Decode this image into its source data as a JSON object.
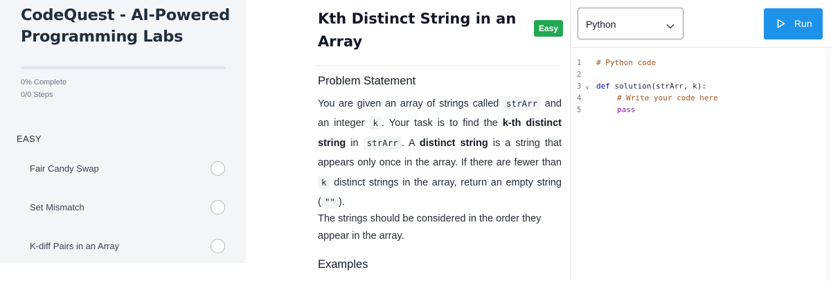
{
  "sidebar": {
    "app_title": "CodeQuest - AI-Powered Programming Labs",
    "progress_percent": 0,
    "progress_text": "0% Complete",
    "steps_text": "0/0 Steps",
    "level_heading": "EASY",
    "lessons": [
      {
        "label": "Fair Candy Swap",
        "completed": false
      },
      {
        "label": "Set Mismatch",
        "completed": false
      },
      {
        "label": "K-diff Pairs in an Array",
        "completed": false
      }
    ]
  },
  "problem": {
    "title": "Kth Distinct String in an Array",
    "difficulty": "Easy",
    "difficulty_color": "#22a853",
    "statement_heading": "Problem Statement",
    "statement": {
      "p1": "You are given an array of strings called ",
      "code1": "strArr",
      "p2": " and an integer ",
      "code2": "k",
      "p3": ". Your task is to find the ",
      "bold1": "k-th distinct string",
      "p4": " in ",
      "code3": "strArr",
      "p5": ". A ",
      "bold2": "distinct string",
      "p6": " is a string that appears only once in the array. If there are fewer than ",
      "code4": "k",
      "p7": " distinct strings in the array, return an empty string (",
      "code5": "\"\"",
      "p8": ")."
    },
    "order_note": "The strings should be considered in the order they appear in the array.",
    "examples_heading": "Examples"
  },
  "editor": {
    "language": "Python",
    "run_label": "Run",
    "accent_color": "#1d92e8",
    "line_numbers": [
      "1",
      "2",
      "3",
      "4",
      "5"
    ],
    "code": {
      "line1": "# Python code",
      "line3_kw": "def",
      "line3_rest": " solution(strArr, k):",
      "line4": "# Write your code here",
      "line5": "pass"
    }
  }
}
